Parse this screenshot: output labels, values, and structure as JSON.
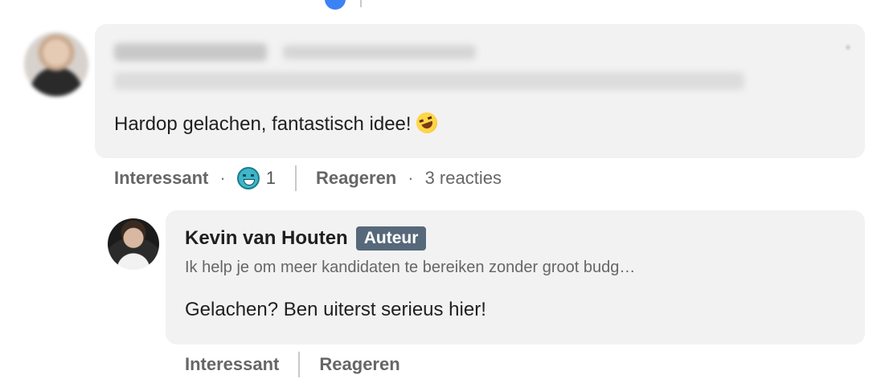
{
  "comments": [
    {
      "text": "Hardop gelachen, fantastisch idee!",
      "actions": {
        "like_label": "Interessant",
        "reaction_count": "1",
        "reply_label": "Reageren",
        "replies_text": "3 reacties"
      }
    },
    {
      "author": "Kevin van Houten",
      "badge": "Auteur",
      "headline": "Ik help je om meer kandidaten te bereiken zonder groot budg…",
      "text": "Gelachen? Ben uiterst serieus hier!",
      "actions": {
        "like_label": "Interessant",
        "reply_label": "Reageren"
      }
    }
  ],
  "colors": {
    "bubble_bg": "#f2f2f2",
    "badge_bg": "#56687a",
    "muted_text": "#666666"
  },
  "icons": {
    "reaction": "funny-reaction-icon",
    "emoji": "rofl-emoji-icon"
  }
}
